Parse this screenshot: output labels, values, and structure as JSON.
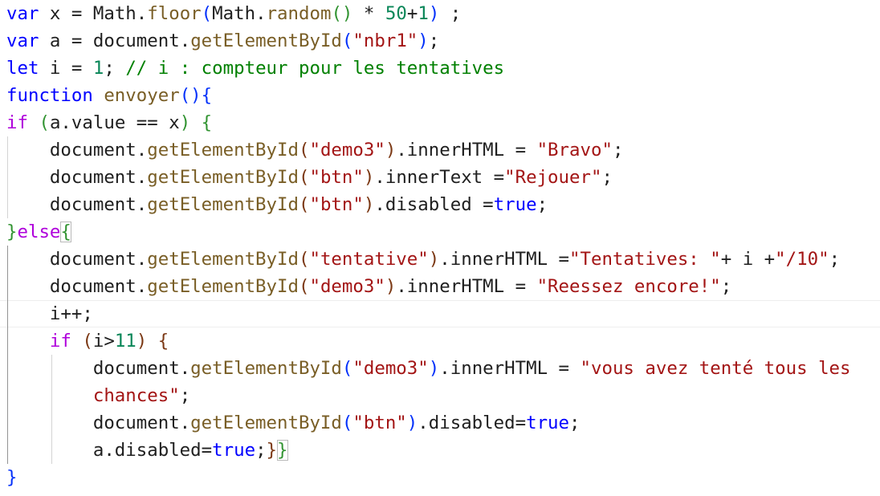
{
  "editor": {
    "lines": [
      [
        {
          "t": "var",
          "c": "kw"
        },
        {
          "t": " x = Math."
        },
        {
          "t": "floor",
          "c": "fn"
        },
        {
          "t": "(",
          "c": "b1"
        },
        {
          "t": "Math."
        },
        {
          "t": "random",
          "c": "fn"
        },
        {
          "t": "()",
          "c": "b2"
        },
        {
          "t": " * "
        },
        {
          "t": "50",
          "c": "num"
        },
        {
          "t": "+"
        },
        {
          "t": "1",
          "c": "num"
        },
        {
          "t": ")",
          "c": "b1"
        },
        {
          "t": " ;"
        }
      ],
      [
        {
          "t": "var",
          "c": "kw"
        },
        {
          "t": " a = document."
        },
        {
          "t": "getElementById",
          "c": "fn"
        },
        {
          "t": "(",
          "c": "b1"
        },
        {
          "t": "\"nbr1\"",
          "c": "str"
        },
        {
          "t": ")",
          "c": "b1"
        },
        {
          "t": ";"
        }
      ],
      [
        {
          "t": "let",
          "c": "kw"
        },
        {
          "t": " i = "
        },
        {
          "t": "1",
          "c": "num"
        },
        {
          "t": "; "
        },
        {
          "t": "// i : compteur pour les tentatives",
          "c": "cmt"
        }
      ],
      [
        {
          "t": "function",
          "c": "kw"
        },
        {
          "t": " "
        },
        {
          "t": "envoyer",
          "c": "fn"
        },
        {
          "t": "(){",
          "c": "b1"
        }
      ],
      [
        {
          "t": "if",
          "c": "ctl"
        },
        {
          "t": " "
        },
        {
          "t": "(",
          "c": "b2"
        },
        {
          "t": "a.value == x"
        },
        {
          "t": ")",
          "c": "b2"
        },
        {
          "t": " "
        },
        {
          "t": "{",
          "c": "b2"
        }
      ],
      [
        {
          "t": "    document."
        },
        {
          "t": "getElementById",
          "c": "fn"
        },
        {
          "t": "(",
          "c": "b3"
        },
        {
          "t": "\"demo3\"",
          "c": "str"
        },
        {
          "t": ")",
          "c": "b3"
        },
        {
          "t": ".innerHTML = "
        },
        {
          "t": "\"Bravo\"",
          "c": "str"
        },
        {
          "t": ";"
        }
      ],
      [
        {
          "t": "    document."
        },
        {
          "t": "getElementById",
          "c": "fn"
        },
        {
          "t": "(",
          "c": "b3"
        },
        {
          "t": "\"btn\"",
          "c": "str"
        },
        {
          "t": ")",
          "c": "b3"
        },
        {
          "t": ".innerText ="
        },
        {
          "t": "\"Rejouer\"",
          "c": "str"
        },
        {
          "t": ";"
        }
      ],
      [
        {
          "t": "    document."
        },
        {
          "t": "getElementById",
          "c": "fn"
        },
        {
          "t": "(",
          "c": "b3"
        },
        {
          "t": "\"btn\"",
          "c": "str"
        },
        {
          "t": ")",
          "c": "b3"
        },
        {
          "t": ".disabled ="
        },
        {
          "t": "true",
          "c": "kw"
        },
        {
          "t": ";"
        }
      ],
      [
        {
          "t": "}",
          "c": "b2"
        },
        {
          "t": "else",
          "c": "ctl"
        },
        {
          "t": "{",
          "c": "b2",
          "m": 1
        }
      ],
      [
        {
          "t": "    document."
        },
        {
          "t": "getElementById",
          "c": "fn"
        },
        {
          "t": "(",
          "c": "b3"
        },
        {
          "t": "\"tentative\"",
          "c": "str"
        },
        {
          "t": ")",
          "c": "b3"
        },
        {
          "t": ".innerHTML ="
        },
        {
          "t": "\"Tentatives: \"",
          "c": "str"
        },
        {
          "t": "+ i +"
        },
        {
          "t": "\"/10\"",
          "c": "str"
        },
        {
          "t": ";"
        }
      ],
      [
        {
          "t": "    document."
        },
        {
          "t": "getElementById",
          "c": "fn"
        },
        {
          "t": "(",
          "c": "b3"
        },
        {
          "t": "\"demo3\"",
          "c": "str"
        },
        {
          "t": ")",
          "c": "b3"
        },
        {
          "t": ".innerHTML = "
        },
        {
          "t": "\"Reessez encore!\"",
          "c": "str"
        },
        {
          "t": ";"
        }
      ],
      [
        {
          "t": "    i++;"
        }
      ],
      [
        {
          "t": "    "
        },
        {
          "t": "if",
          "c": "ctl"
        },
        {
          "t": " "
        },
        {
          "t": "(",
          "c": "b3"
        },
        {
          "t": "i>"
        },
        {
          "t": "11",
          "c": "num"
        },
        {
          "t": ")",
          "c": "b3"
        },
        {
          "t": " "
        },
        {
          "t": "{",
          "c": "b3"
        }
      ],
      [
        {
          "t": "        document."
        },
        {
          "t": "getElementById",
          "c": "fn"
        },
        {
          "t": "(",
          "c": "b1"
        },
        {
          "t": "\"demo3\"",
          "c": "str"
        },
        {
          "t": ")",
          "c": "b1"
        },
        {
          "t": ".innerHTML = "
        },
        {
          "t": "\"vous avez tenté tous les",
          "c": "str"
        }
      ],
      [
        {
          "t": "        "
        },
        {
          "t": "chances\"",
          "c": "str"
        },
        {
          "t": ";"
        }
      ],
      [
        {
          "t": "        document."
        },
        {
          "t": "getElementById",
          "c": "fn"
        },
        {
          "t": "(",
          "c": "b1"
        },
        {
          "t": "\"btn\"",
          "c": "str"
        },
        {
          "t": ")",
          "c": "b1"
        },
        {
          "t": ".disabled="
        },
        {
          "t": "true",
          "c": "kw"
        },
        {
          "t": ";"
        }
      ],
      [
        {
          "t": "        a.disabled="
        },
        {
          "t": "true",
          "c": "kw"
        },
        {
          "t": ";"
        },
        {
          "t": "}",
          "c": "b3"
        },
        {
          "t": "}",
          "c": "b2",
          "m": 1
        }
      ],
      [
        {
          "t": "}",
          "c": "b1"
        }
      ]
    ],
    "colors": {
      "keyword": "#0000ff",
      "control": "#af00db",
      "function": "#795e26",
      "string": "#a31515",
      "number": "#098658",
      "comment": "#008000",
      "bracket_level_1": "#0431fa",
      "bracket_level_2": "#319331",
      "bracket_level_3": "#7b3814"
    }
  }
}
